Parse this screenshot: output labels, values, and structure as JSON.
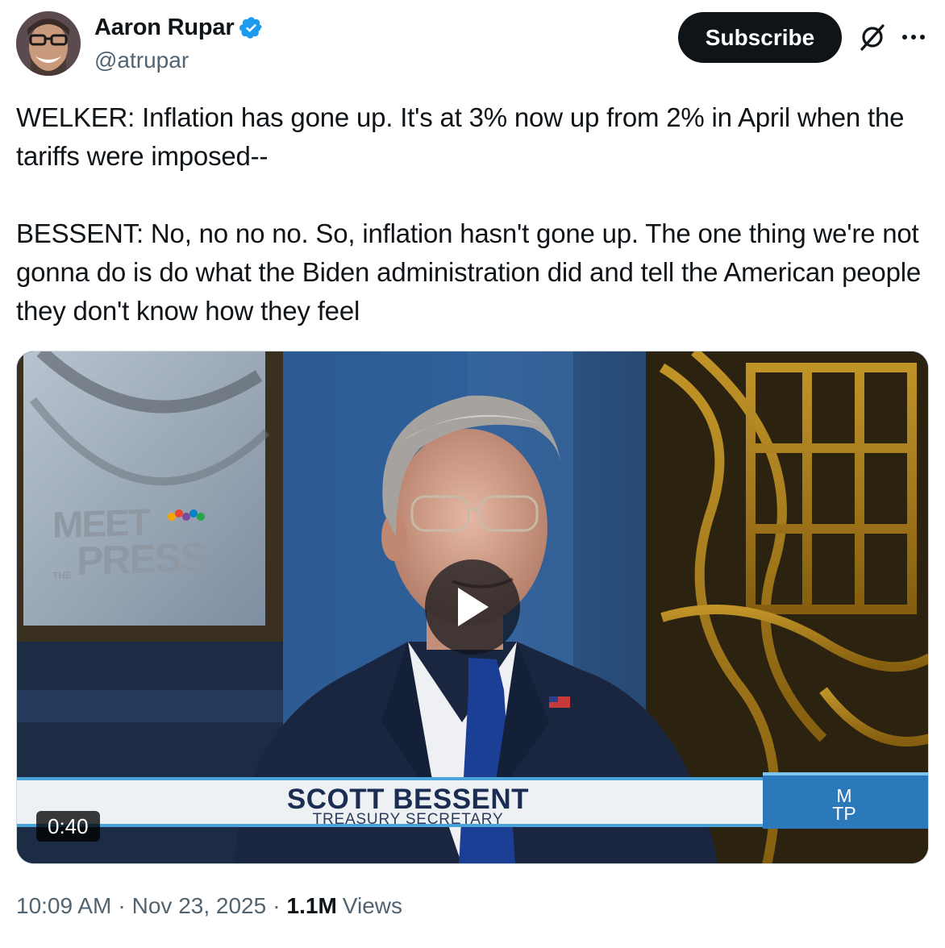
{
  "author": {
    "name": "Aaron Rupar",
    "handle": "@atrupar"
  },
  "actions": {
    "subscribe_label": "Subscribe"
  },
  "tweet": {
    "paragraph1": "WELKER: Inflation has gone up. It's at 3% now up from 2% in April when the tariffs were imposed--",
    "paragraph2": "BESSENT: No, no no no. So, inflation hasn't gone up. The one thing we're not gonna do is do what the Biden administration did and tell the American people they don't know how they feel"
  },
  "media": {
    "duration": "0:40",
    "lower_third_name": "SCOTT BESSENT",
    "lower_third_title": "TREASURY SECRETARY",
    "bug_line1": "M",
    "bug_line2": "TP",
    "backdrop_logo_line1": "MEET",
    "backdrop_logo_line2": "THE",
    "backdrop_logo_line3": "PRESS"
  },
  "meta": {
    "time": "10:09 AM",
    "separator": "·",
    "date": "Nov 23, 2025",
    "views_count": "1.1M",
    "views_label": "Views"
  },
  "colors": {
    "verified": "#1d9bf0",
    "subscribe_bg": "#0f1419",
    "secondary_text": "#536471"
  },
  "icons": {
    "verified": "verified-badge-icon",
    "grok": "grok-icon",
    "more": "more-icon",
    "play": "play-icon"
  }
}
